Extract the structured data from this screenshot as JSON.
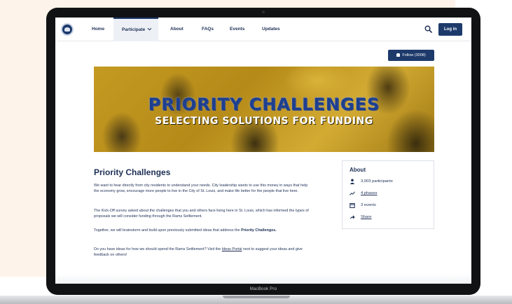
{
  "nav": {
    "items": [
      {
        "label": "Home"
      },
      {
        "label": "Participate"
      },
      {
        "label": "About"
      },
      {
        "label": "FAQs"
      },
      {
        "label": "Events"
      },
      {
        "label": "Updates"
      }
    ],
    "active": "Participate",
    "login_label": "Log in"
  },
  "follow": {
    "label": "Follow (3008)"
  },
  "banner": {
    "title": "PRIORITY CHALLENGES",
    "subtitle": "SELECTING SOLUTIONS FOR FUNDING"
  },
  "main": {
    "heading": "Priority Challenges",
    "p1": "We want to hear directly from city residents to understand your needs. City leadership wants to use this money in ways that help the economy grow, encourage more people to live in the City of St. Louis, and make life better for the people that live here.",
    "p2": "The Kick-Off survey asked about the challenges that you and others face living here in St. Louis, which has informed the types of proposals we will consider funding through the Rams Settlement.",
    "p3_pre": "Together, we will brainstorm and build upon previously submitted ideas that address the ",
    "p3_bold": "Priority Challenges.",
    "p4_pre": "Do you have ideas for how we should spend the Rams Settlement? Visit the ",
    "p4_link": "Ideas Portal",
    "p4_post": " next to suggest your ideas and give feedback on others!"
  },
  "about": {
    "title": "About",
    "participants": "3,003 participants",
    "phases": "4 phases",
    "events": "3 events",
    "share": "Share"
  },
  "device": {
    "label": "MacBook Pro"
  },
  "colors": {
    "brand_navy": "#1d3a6b",
    "banner_gold": "#c49a22",
    "title_blue": "#1e3f8f"
  }
}
